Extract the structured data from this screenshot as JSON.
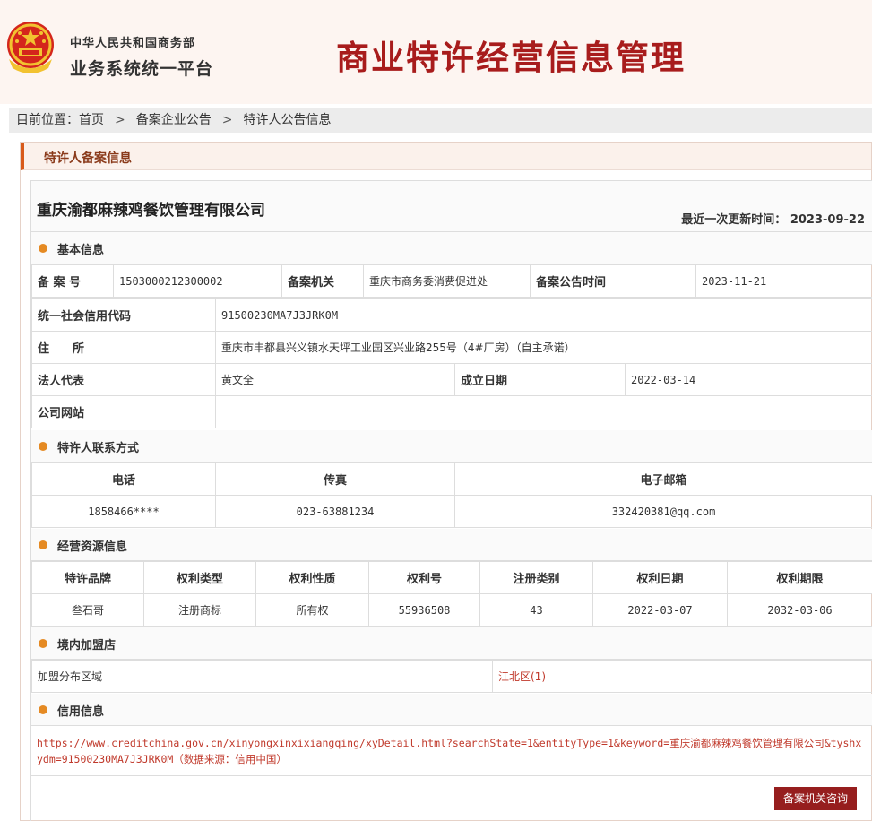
{
  "header": {
    "org": "中华人民共和国商务部",
    "platform": "业务系统统一平台",
    "title": "商业特许经营信息管理",
    "title_color": "#a81c1c"
  },
  "breadcrumb": {
    "prefix": "目前位置：",
    "items": [
      "首页",
      "备案企业公告",
      "特许人公告信息"
    ],
    "separator": ">"
  },
  "panel": {
    "title": "特许人备案信息",
    "accent": "#d85a1a"
  },
  "company": {
    "name": "重庆渝都麻辣鸡餐饮管理有限公司",
    "updated_label": "最近一次更新时间：",
    "updated_value": "2023-09-22"
  },
  "basic": {
    "section_title": "基本信息",
    "record_no_label": "备 案 号",
    "record_no": "1503000212300002",
    "authority_label": "备案机关",
    "authority": "重庆市商务委消费促进处",
    "notice_time_label": "备案公告时间",
    "notice_time": "2023-11-21",
    "credit_code_label": "统一社会信用代码",
    "credit_code": "91500230MA7J3JRK0M",
    "address_label": "住　　所",
    "address": "重庆市丰都县兴义镇水天坪工业园区兴业路255号（4#厂房）（自主承诺）",
    "legal_rep_label": "法人代表",
    "legal_rep": "黄文全",
    "founded_label": "成立日期",
    "founded": "2022-03-14",
    "website_label": "公司网站",
    "website": ""
  },
  "contact": {
    "section_title": "特许人联系方式",
    "headers": [
      "电话",
      "传真",
      "电子邮箱"
    ],
    "phone": "1858466****",
    "fax": "023-63881234",
    "email": "332420381@qq.com"
  },
  "resources": {
    "section_title": "经营资源信息",
    "headers": [
      "特许品牌",
      "权利类型",
      "权利性质",
      "权利号",
      "注册类别",
      "权利日期",
      "权利期限"
    ],
    "row": [
      "叁石哥",
      "注册商标",
      "所有权",
      "55936508",
      "43",
      "2022-03-07",
      "2032-03-06"
    ]
  },
  "stores": {
    "section_title": "境内加盟店",
    "label": "加盟分布区域",
    "value": "江北区(1)"
  },
  "credit": {
    "section_title": "信用信息",
    "link": "https://www.creditchina.gov.cn/xinyongxinxixiangqing/xyDetail.html?searchState=1&entityType=1&keyword=重庆渝都麻辣鸡餐饮管理有限公司&tyshxydm=91500230MA7J3JRK0M（数据来源：信用中国）"
  },
  "button": {
    "consult": "备案机关咨询",
    "color": "#961e1e"
  }
}
